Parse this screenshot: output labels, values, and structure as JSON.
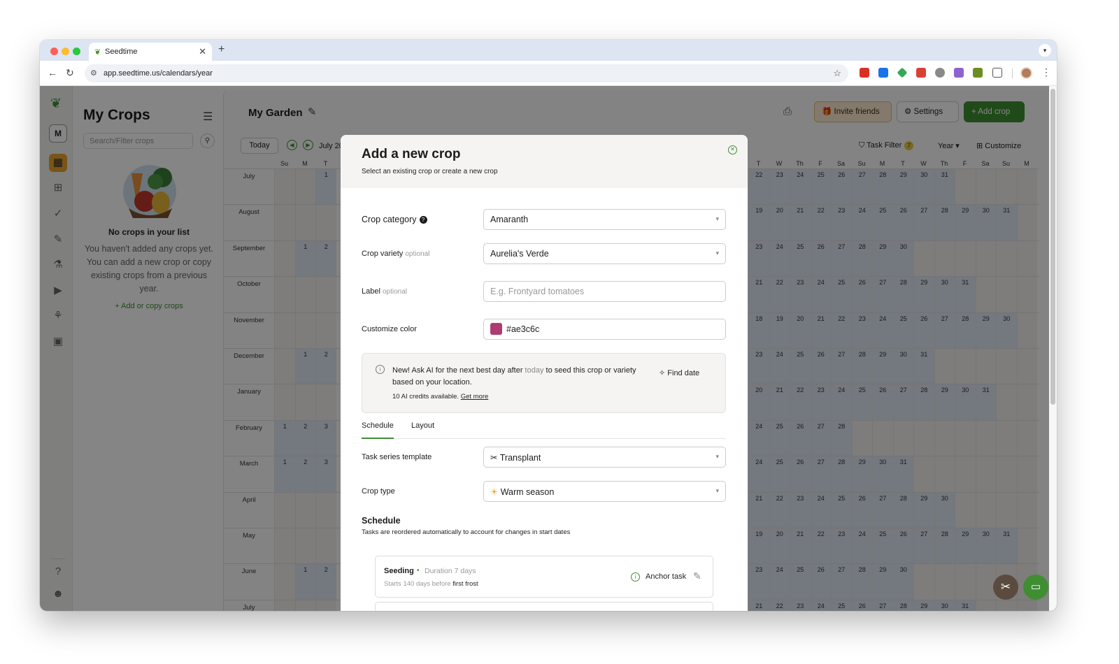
{
  "browser": {
    "tab_title": "Seedtime",
    "url": "app.seedtime.us/calendars/year",
    "new_tab": "+",
    "tab_close": "✕"
  },
  "rail": {
    "avatar_letter": "M",
    "icons": [
      "calendar-icon",
      "grid-icon",
      "check-icon",
      "edit-icon",
      "tools-icon",
      "video-icon",
      "network-icon",
      "briefcase-icon",
      "help-icon",
      "profile-icon"
    ]
  },
  "crops": {
    "title": "My Crops",
    "search_placeholder": "Search/Filter crops",
    "empty_title": "No crops in your list",
    "empty_text": "You haven't added any crops yet. You can add a new crop or copy existing crops from a previous year.",
    "add_link": "+ Add or copy crops"
  },
  "garden": {
    "title": "My Garden",
    "invite_label": "Invite friends",
    "settings_label": "Settings",
    "add_crop_label": "+ Add crop",
    "today_label": "Today",
    "month_label": "July 20",
    "task_filter_label": "Task Filter",
    "task_filter_count": "7",
    "view_label": "Year",
    "customize_label": "Customize"
  },
  "calendar": {
    "left_dow": [
      "Su",
      "M",
      "T"
    ],
    "right_dow": [
      "T",
      "W",
      "Th",
      "F",
      "Sa",
      "Su",
      "M",
      "T",
      "W",
      "Th",
      "F",
      "Sa",
      "Su",
      "M"
    ],
    "months": [
      {
        "name": "July",
        "left": [
          "",
          "",
          "1"
        ],
        "right": [
          "22",
          "23",
          "24",
          "25",
          "26",
          "27",
          "28",
          "29",
          "30",
          "31",
          "",
          "",
          "",
          ""
        ]
      },
      {
        "name": "August",
        "left": [
          "",
          "",
          ""
        ],
        "right": [
          "19",
          "20",
          "21",
          "22",
          "23",
          "24",
          "25",
          "26",
          "27",
          "28",
          "29",
          "30",
          "31",
          ""
        ]
      },
      {
        "name": "September",
        "left": [
          "",
          "1",
          "2"
        ],
        "right": [
          "23",
          "24",
          "25",
          "26",
          "27",
          "28",
          "29",
          "30",
          "",
          "",
          "",
          "",
          "",
          ""
        ]
      },
      {
        "name": "October",
        "left": [
          "",
          "",
          ""
        ],
        "right": [
          "21",
          "22",
          "23",
          "24",
          "25",
          "26",
          "27",
          "28",
          "29",
          "30",
          "31",
          "",
          "",
          ""
        ]
      },
      {
        "name": "November",
        "left": [
          "",
          "",
          ""
        ],
        "right": [
          "18",
          "19",
          "20",
          "21",
          "22",
          "23",
          "24",
          "25",
          "26",
          "27",
          "28",
          "29",
          "30",
          ""
        ]
      },
      {
        "name": "December",
        "left": [
          "",
          "1",
          "2"
        ],
        "right": [
          "23",
          "24",
          "25",
          "26",
          "27",
          "28",
          "29",
          "30",
          "31",
          "",
          "",
          "",
          "",
          ""
        ]
      },
      {
        "name": "January",
        "left": [
          "",
          "",
          ""
        ],
        "right": [
          "20",
          "21",
          "22",
          "23",
          "24",
          "25",
          "26",
          "27",
          "28",
          "29",
          "30",
          "31",
          "",
          ""
        ]
      },
      {
        "name": "February",
        "left": [
          "1",
          "2",
          "3"
        ],
        "right": [
          "24",
          "25",
          "26",
          "27",
          "28",
          "",
          "",
          "",
          "",
          "",
          "",
          "",
          "",
          ""
        ]
      },
      {
        "name": "March",
        "left": [
          "1",
          "2",
          "3"
        ],
        "right": [
          "24",
          "25",
          "26",
          "27",
          "28",
          "29",
          "30",
          "31",
          "",
          "",
          "",
          "",
          "",
          ""
        ]
      },
      {
        "name": "April",
        "left": [
          "",
          "",
          ""
        ],
        "right": [
          "21",
          "22",
          "23",
          "24",
          "25",
          "26",
          "27",
          "28",
          "29",
          "30",
          "",
          "",
          "",
          ""
        ]
      },
      {
        "name": "May",
        "left": [
          "",
          "",
          ""
        ],
        "right": [
          "19",
          "20",
          "21",
          "22",
          "23",
          "24",
          "25",
          "26",
          "27",
          "28",
          "29",
          "30",
          "31",
          ""
        ]
      },
      {
        "name": "June",
        "left": [
          "",
          "1",
          "2"
        ],
        "right": [
          "23",
          "24",
          "25",
          "26",
          "27",
          "28",
          "29",
          "30",
          "",
          "",
          "",
          "",
          "",
          ""
        ]
      },
      {
        "name": "July",
        "left": [
          "",
          "",
          ""
        ],
        "right": [
          "21",
          "22",
          "23",
          "24",
          "25",
          "26",
          "27",
          "28",
          "29",
          "30",
          "31",
          "",
          "",
          ""
        ]
      }
    ]
  },
  "modal": {
    "title": "Add a new crop",
    "subtitle": "Select an existing crop or create a new crop",
    "crop_category_label": "Crop category",
    "crop_category_value": "Amaranth",
    "crop_variety_label": "Crop variety",
    "optional": "optional",
    "crop_variety_value": "Aurelia's Verde",
    "label_label": "Label",
    "label_placeholder": "E.g. Frontyard tomatoes",
    "color_label": "Customize color",
    "color_value": "#ae3c6c",
    "ai_text_1": "New! Ask AI for the next best day after",
    "ai_today": "today",
    "ai_text_2": "to seed this crop or variety based on your location.",
    "ai_credits": "10 AI credits available.",
    "ai_get_more": "Get more",
    "ai_find_date": "Find date",
    "tab_schedule": "Schedule",
    "tab_layout": "Layout",
    "task_template_label": "Task series template",
    "task_template_value": "Transplant",
    "crop_type_label": "Crop type",
    "crop_type_value": "Warm season",
    "schedule_title": "Schedule",
    "schedule_sub": "Tasks are reordered automatically to account for changes in start dates",
    "task": {
      "name": "Seeding",
      "duration": "Duration 7 days",
      "starts": "Starts 140 days before",
      "anchor_ref": "first frost",
      "anchor_label": "Anchor task"
    }
  },
  "colors": {
    "accent_green": "#3f8e32",
    "rail_active": "#e9a42e",
    "crop_color": "#ae3c6c"
  }
}
